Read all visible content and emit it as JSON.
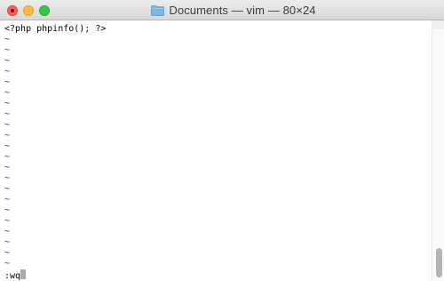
{
  "window": {
    "title": "Documents — vim — 80×24",
    "icons": {
      "close": "close-button",
      "minimize": "minimize-button",
      "maximize": "zoom-button",
      "folder": "folder-icon"
    },
    "colors": {
      "close": "#fc605c",
      "minimize": "#fdbc40",
      "maximize": "#34c84a",
      "folder": "#7eb6e6"
    }
  },
  "vim": {
    "first_line": "<?php phpinfo(); ?>",
    "tilde_char": "~",
    "empty_line_count": 22,
    "command_line": ":wq",
    "tilde_color": "#1d1dd6",
    "cursor_color": "#a9a9a9"
  },
  "scrollbar": {
    "position_fraction": 0.95
  }
}
